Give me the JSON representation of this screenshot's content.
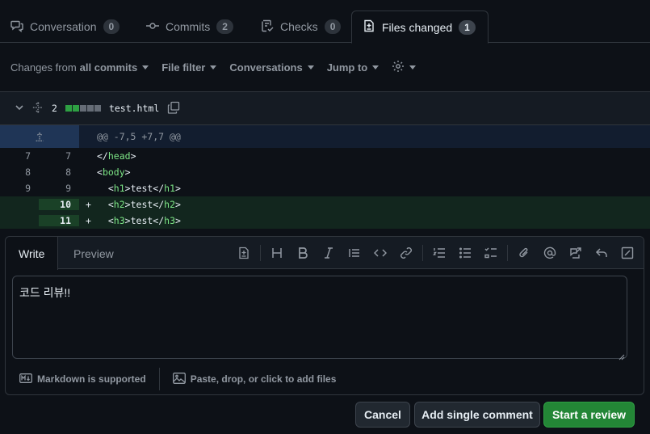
{
  "tabs": [
    {
      "label": "Conversation",
      "count": "0"
    },
    {
      "label": "Commits",
      "count": "2"
    },
    {
      "label": "Checks",
      "count": "0"
    },
    {
      "label": "Files changed",
      "count": "1"
    }
  ],
  "toolbar": {
    "changes_prefix": "Changes from",
    "changes_value": "all commits",
    "file_filter": "File filter",
    "conversations": "Conversations",
    "jump_to": "Jump to"
  },
  "file": {
    "changed_lines": "2",
    "name": "test.html",
    "diffstat_colors": [
      "#2ea043",
      "#2ea043",
      "#656c76",
      "#656c76",
      "#656c76"
    ]
  },
  "diff": {
    "hunk": "@@ -7,5 +7,7 @@",
    "rows": [
      {
        "old": "7",
        "new": "7",
        "sign": "",
        "code": "</head>"
      },
      {
        "old": "8",
        "new": "8",
        "sign": "",
        "code": "<body>"
      },
      {
        "old": "9",
        "new": "9",
        "sign": "",
        "code": "  <h1>test</h1>"
      },
      {
        "old": "",
        "new": "10",
        "sign": "+",
        "code": "  <h2>test</h2>"
      },
      {
        "old": "",
        "new": "11",
        "sign": "+",
        "code": "  <h3>test</h3>"
      }
    ]
  },
  "comment": {
    "write_tab": "Write",
    "preview_tab": "Preview",
    "body": "코드 리뷰!!",
    "markdown_note": "Markdown is supported",
    "attach_note": "Paste, drop, or click to add files"
  },
  "buttons": {
    "cancel": "Cancel",
    "add_single": "Add single comment",
    "start_review": "Start a review"
  },
  "colors": {
    "accent_green": "#238636",
    "addition_bg": "#12261e",
    "hunk_bg": "#121d2f"
  }
}
